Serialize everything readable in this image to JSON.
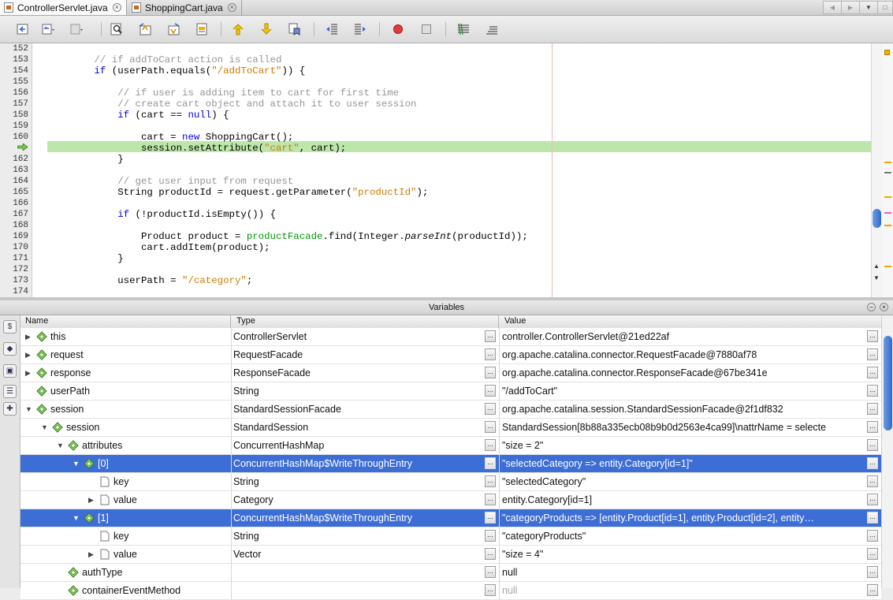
{
  "tabs": [
    {
      "label": "ControllerServlet.java",
      "active": true
    },
    {
      "label": "ShoppingCart.java",
      "active": false
    }
  ],
  "toolbar_icons": [
    "back-icon",
    "history-icon",
    "history-forward-icon",
    "find-icon",
    "find-previous-icon",
    "find-next-icon",
    "toggle-highlight-icon",
    "previous-bookmark-icon",
    "next-bookmark-icon",
    "toggle-bookmark-icon",
    "shift-left-icon",
    "shift-right-icon",
    "start-macro-icon",
    "stop-macro-icon",
    "comment-icon",
    "uncomment-icon"
  ],
  "editor": {
    "lines": [
      {
        "n": "152",
        "html": ""
      },
      {
        "n": "153",
        "html": "        <span class=\"cm\">// if addToCart action is called</span>"
      },
      {
        "n": "154",
        "html": "        <span class=\"kw\">if</span> (userPath.equals(<span class=\"str\">\"/addToCart\"</span>)) {"
      },
      {
        "n": "155",
        "html": ""
      },
      {
        "n": "156",
        "html": "            <span class=\"cm\">// if user is adding item to cart for first time</span>"
      },
      {
        "n": "157",
        "html": "            <span class=\"cm\">// create cart object and attach it to user session</span>"
      },
      {
        "n": "158",
        "html": "            <span class=\"kw\">if</span> (cart == <span class=\"kw\">null</span>) {"
      },
      {
        "n": "159",
        "html": ""
      },
      {
        "n": "160",
        "html": "                cart = <span class=\"kw\">new</span> ShoppingCart();"
      },
      {
        "n": "",
        "html": "                session.setAttribute(<span class=\"str\">\"cart\"</span>, cart);"
      },
      {
        "n": "162",
        "html": "            }"
      },
      {
        "n": "163",
        "html": ""
      },
      {
        "n": "164",
        "html": "            <span class=\"cm\">// get user input from request</span>"
      },
      {
        "n": "165",
        "html": "            String productId = request.getParameter(<span class=\"str\">\"productId\"</span>);"
      },
      {
        "n": "166",
        "html": ""
      },
      {
        "n": "167",
        "html": "            <span class=\"kw\">if</span> (!productId.isEmpty()) {"
      },
      {
        "n": "168",
        "html": ""
      },
      {
        "n": "169",
        "html": "                Product product = <span class=\"fld\">productFacade</span>.find(Integer.<span class=\"it\">parseInt</span>(productId));"
      },
      {
        "n": "170",
        "html": "                cart.addItem(product);"
      },
      {
        "n": "171",
        "html": "            }"
      },
      {
        "n": "172",
        "html": ""
      },
      {
        "n": "173",
        "html": "            userPath = <span class=\"str\">\"/category\"</span>;"
      },
      {
        "n": "174",
        "html": ""
      }
    ],
    "current_line_index": 9
  },
  "variables": {
    "title": "Variables",
    "columns": {
      "name": "Name",
      "type": "Type",
      "value": "Value"
    },
    "rows": [
      {
        "name": "this",
        "type": "ControllerServlet",
        "value": "controller.ControllerServlet@21ed22af",
        "depth": 0,
        "exp": "collapsed",
        "icon": "green-diamond-icon",
        "selected": false,
        "dim": false
      },
      {
        "name": "request",
        "type": "RequestFacade",
        "value": "org.apache.catalina.connector.RequestFacade@7880af78",
        "depth": 0,
        "exp": "collapsed",
        "icon": "green-diamond-icon",
        "selected": false,
        "dim": false
      },
      {
        "name": "response",
        "type": "ResponseFacade",
        "value": "org.apache.catalina.connector.ResponseFacade@67be341e",
        "depth": 0,
        "exp": "collapsed",
        "icon": "green-diamond-icon",
        "selected": false,
        "dim": false
      },
      {
        "name": "userPath",
        "type": "String",
        "value": "\"/addToCart\"",
        "depth": 0,
        "exp": "none",
        "icon": "green-diamond-icon",
        "selected": false,
        "dim": false
      },
      {
        "name": "session",
        "type": "StandardSessionFacade",
        "value": "org.apache.catalina.session.StandardSessionFacade@2f1df832",
        "depth": 0,
        "exp": "expanded",
        "icon": "green-diamond-icon",
        "selected": false,
        "dim": false
      },
      {
        "name": "session",
        "type": "StandardSession",
        "value": "StandardSession[8b88a335ecb08b9b0d2563e4ca99]\\nattrName = selecte",
        "depth": 1,
        "exp": "expanded",
        "icon": "green-diamond-icon",
        "selected": false,
        "dim": false
      },
      {
        "name": "attributes",
        "type": "ConcurrentHashMap",
        "value": "\"size = 2\"",
        "depth": 2,
        "exp": "expanded",
        "icon": "green-diamond-icon",
        "selected": false,
        "dim": false
      },
      {
        "name": "[0]",
        "type": "ConcurrentHashMap$WriteThroughEntry",
        "value": "\"selectedCategory => entity.Category[id=1]\"",
        "depth": 3,
        "exp": "expanded",
        "icon": "green-diamond-icon",
        "selected": true,
        "dim": false
      },
      {
        "name": "key",
        "type": "String",
        "value": "\"selectedCategory\"",
        "depth": 4,
        "exp": "none",
        "icon": "file-icon",
        "selected": false,
        "dim": false
      },
      {
        "name": "value",
        "type": "Category",
        "value": "entity.Category[id=1]",
        "depth": 4,
        "exp": "collapsed",
        "icon": "file-icon",
        "selected": false,
        "dim": false
      },
      {
        "name": "[1]",
        "type": "ConcurrentHashMap$WriteThroughEntry",
        "value": "\"categoryProducts => [entity.Product[id=1], entity.Product[id=2], entity…",
        "depth": 3,
        "exp": "expanded",
        "icon": "green-diamond-icon",
        "selected": true,
        "dim": false
      },
      {
        "name": "key",
        "type": "String",
        "value": "\"categoryProducts\"",
        "depth": 4,
        "exp": "none",
        "icon": "file-icon",
        "selected": false,
        "dim": false
      },
      {
        "name": "value",
        "type": "Vector",
        "value": "\"size = 4\"",
        "depth": 4,
        "exp": "collapsed",
        "icon": "file-icon",
        "selected": false,
        "dim": false
      },
      {
        "name": "authType",
        "type": "",
        "value": "null",
        "depth": 2,
        "exp": "none",
        "icon": "green-diamond-icon",
        "selected": false,
        "dim": false
      },
      {
        "name": "containerEventMethod",
        "type": "",
        "value": "null",
        "depth": 2,
        "exp": "none",
        "icon": "green-diamond-icon",
        "selected": false,
        "dim": true
      }
    ]
  },
  "left_toolbar": [
    "watches-icon",
    "breakpoints-icon",
    "sessions-icon",
    "call-stack-icon",
    "new-watch-icon"
  ]
}
